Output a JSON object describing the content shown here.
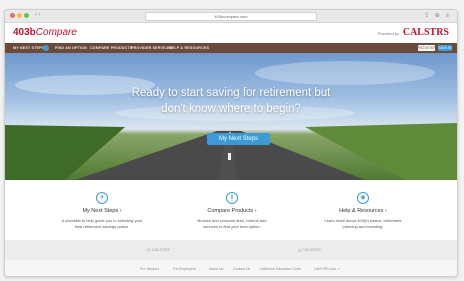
{
  "browser": {
    "url": "403bcompare.com",
    "nav_arrows": "‹ ›",
    "right_icons": "⇪ ⊕ ≡"
  },
  "header": {
    "logo_prefix": "403b",
    "logo_suffix": "Compare",
    "powered_by": "Provided by",
    "partner_logo": "CALSTRS"
  },
  "navbar": {
    "items": [
      "MY NEXT STEPS",
      "FIND AN OPTION",
      "COMPARE PRODUCTS",
      "PROVIDER SERVICES",
      "HELP & RESOURCES"
    ],
    "badge": "1",
    "register": "REGISTER",
    "login": "SIGN IN"
  },
  "hero": {
    "line1": "Ready to start saving for retirement but",
    "line2": "don't know where to begin?",
    "cta": "My Next Steps"
  },
  "features": [
    {
      "icon": "compass-icon",
      "glyph": "✈",
      "title": "My Next Steps ›",
      "desc1": "A checklist to help guide you in selecting your",
      "desc2": "best retirement savings option."
    },
    {
      "icon": "bars-icon",
      "glyph": "⫴",
      "title": "Compare Products ›",
      "desc1": "Browse and compare fees, returns and",
      "desc2": "services to find your best option."
    },
    {
      "icon": "chat-icon",
      "glyph": "◉",
      "title": "Help & Resources ›",
      "desc1": "Learn more about 403(b) basics, retirement",
      "desc2": "planning and investing."
    }
  ],
  "footer": {
    "logo_left": "◎ CALSTRS",
    "logo_right": "◬ CALSTRS",
    "links": [
      "For Vendors",
      "For Employers",
      "About Us",
      "Contact Us",
      "California Education Code",
      "CalSTRS.com ↗"
    ]
  },
  "colors": {
    "brand_red": "#c8102e",
    "nav_brown": "#6b4a3a",
    "accent_blue": "#3c9ad7"
  }
}
